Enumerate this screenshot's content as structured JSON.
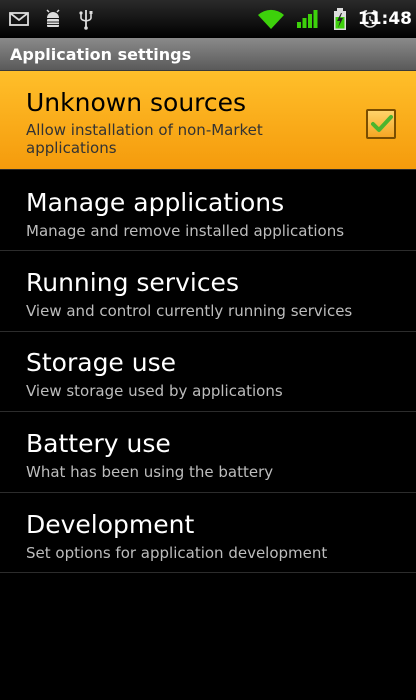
{
  "status_bar": {
    "time": "11:48",
    "icons": [
      "mail-icon",
      "android-debug-icon",
      "usb-icon",
      "wifi-icon",
      "signal-icon",
      "battery-charging-icon",
      "alarm-icon"
    ]
  },
  "title_bar": {
    "title": "Application settings"
  },
  "items": [
    {
      "title": "Unknown sources",
      "summary": "Allow installation of non-Market applications",
      "checked": true
    },
    {
      "title": "Manage applications",
      "summary": "Manage and remove installed applications"
    },
    {
      "title": "Running services",
      "summary": "View and control currently running services"
    },
    {
      "title": "Storage use",
      "summary": "View storage used by applications"
    },
    {
      "title": "Battery use",
      "summary": "What has been using the battery"
    },
    {
      "title": "Development",
      "summary": "Set options for application development"
    }
  ],
  "colors": {
    "selected_bg": "#f7a81a",
    "title_bar_bg": "#6e6e6e",
    "check_green": "#4bb52e"
  }
}
